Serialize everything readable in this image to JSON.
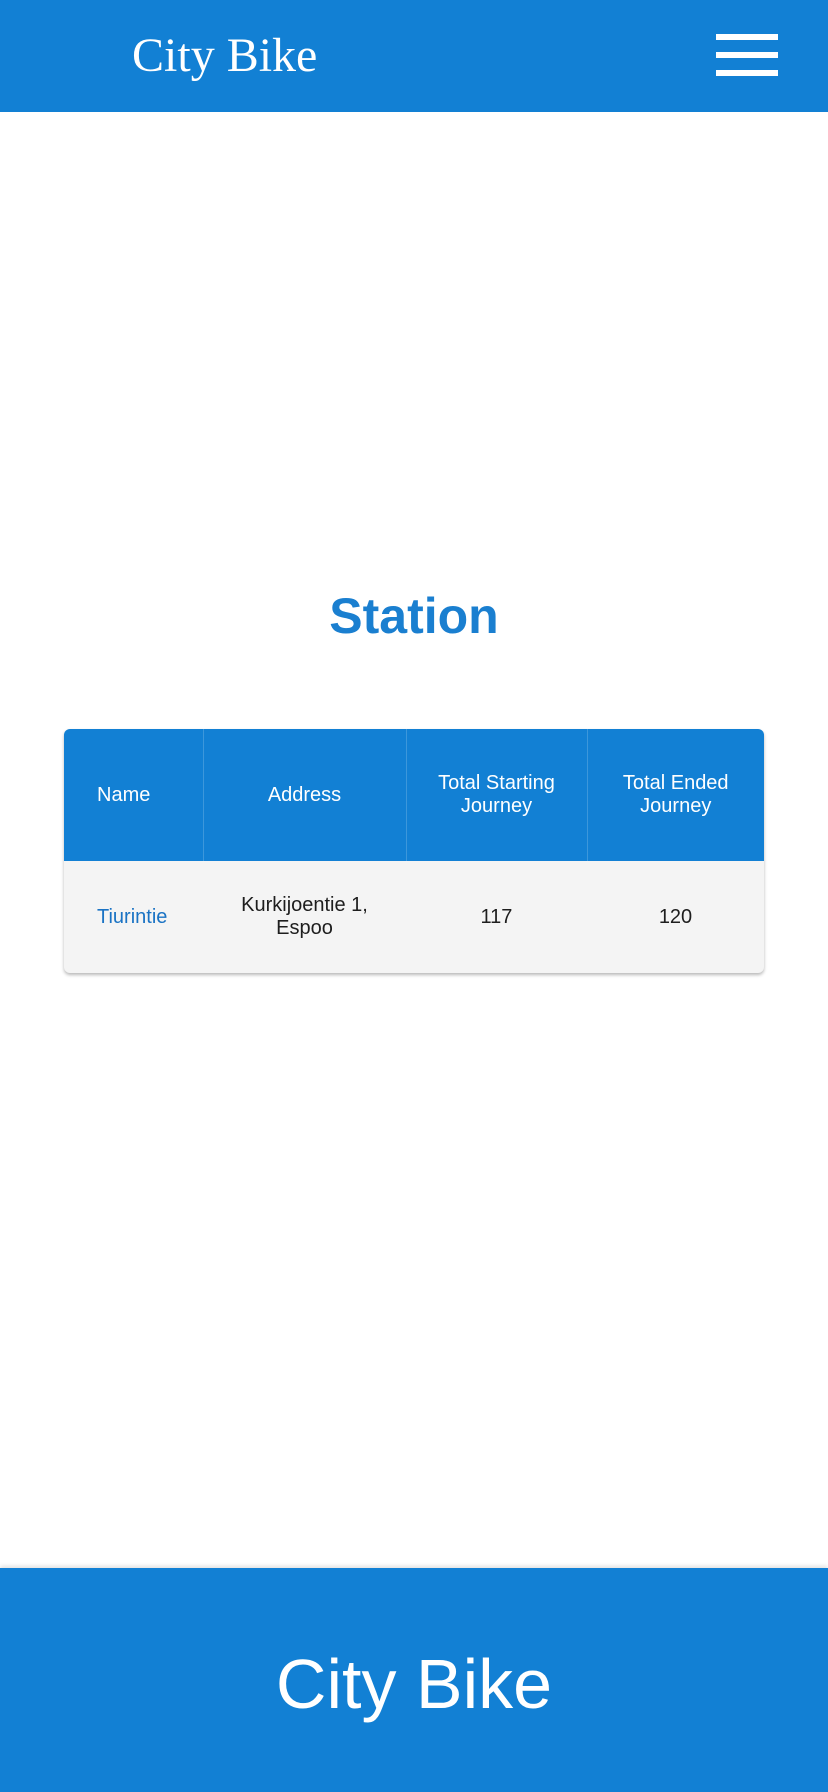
{
  "header": {
    "brand": "City Bike",
    "menu_icon": "hamburger-menu-icon"
  },
  "main": {
    "title": "Station",
    "table": {
      "columns": [
        "Name",
        "Address",
        "Total Starting Journey",
        "Total Ended Journey"
      ],
      "rows": [
        {
          "name": "Tiurintie",
          "address": "Kurkijoentie 1, Espoo",
          "total_starting": "117",
          "total_ended": "120"
        }
      ]
    }
  },
  "footer": {
    "brand": "City Bike"
  },
  "colors": {
    "primary": "#1280d4",
    "title": "#1a7fd0",
    "link": "#1a73c4",
    "row_bg": "#f4f4f4"
  }
}
